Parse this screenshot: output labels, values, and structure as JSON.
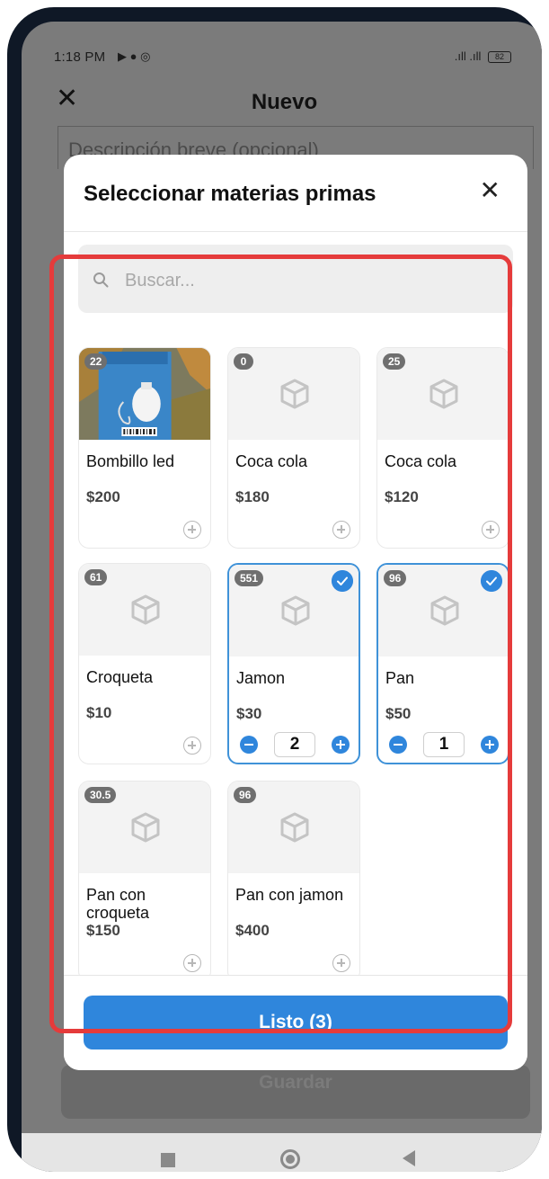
{
  "status_bar": {
    "time": "1:18 PM",
    "battery": "82"
  },
  "app_header": {
    "title": "Nuevo"
  },
  "background": {
    "description_placeholder": "Descripción breve (opcional)",
    "save_label": "Guardar"
  },
  "modal": {
    "title": "Seleccionar materias primas",
    "search_placeholder": "Buscar...",
    "done_label": "Listo (3)",
    "items": [
      {
        "badge": "22",
        "name": "Bombillo led",
        "price": "$200",
        "selected": false
      },
      {
        "badge": "0",
        "name": "Coca cola",
        "price": "$180",
        "selected": false
      },
      {
        "badge": "25",
        "name": "Coca cola",
        "price": "$120",
        "selected": false
      },
      {
        "badge": "61",
        "name": "Croqueta",
        "price": "$10",
        "selected": false
      },
      {
        "badge": "551",
        "name": "Jamon",
        "price": "$30",
        "selected": true,
        "quantity": "2"
      },
      {
        "badge": "96",
        "name": "Pan",
        "price": "$50",
        "selected": true,
        "quantity": "1"
      },
      {
        "badge": "30.5",
        "name": "Pan con croqueta",
        "price": "$150",
        "selected": false
      },
      {
        "badge": "96",
        "name": "Pan con jamon",
        "price": "$400",
        "selected": false
      }
    ]
  },
  "colors": {
    "accent": "#2f86dc",
    "highlight": "#e53b3b"
  }
}
